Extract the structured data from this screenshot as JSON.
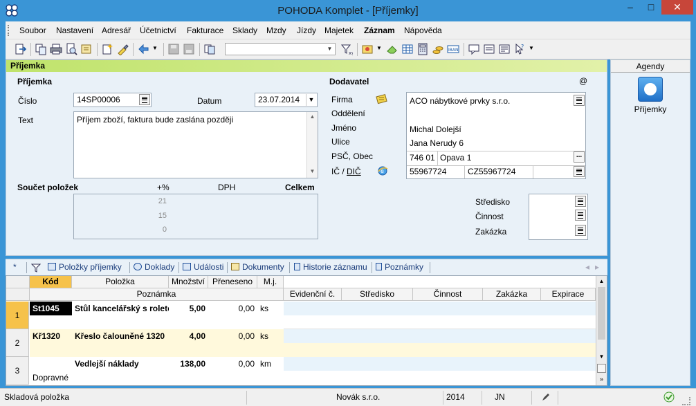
{
  "window": {
    "title": "POHODA Komplet - [Příjemky]",
    "minimize": "–",
    "maximize": "□",
    "close": "✕"
  },
  "menu": [
    "Soubor",
    "Nastavení",
    "Adresář",
    "Účetnictví",
    "Fakturace",
    "Sklady",
    "Mzdy",
    "Jízdy",
    "Majetek",
    "Záznam",
    "Nápověda"
  ],
  "form": {
    "header": "Příjemka",
    "section_left": "Příjemka",
    "cislo_label": "Číslo",
    "cislo_value": "14SP00006",
    "datum_label": "Datum",
    "datum_value": "23.07.2014",
    "text_label": "Text",
    "text_value": "Příjem zboží, faktura bude zaslána později",
    "soucet_label": "Součet položek",
    "plus_pct": "+%",
    "dph": "DPH",
    "celkem": "Celkem",
    "rates": [
      "21",
      "15",
      "0"
    ],
    "section_right": "Dodavatel",
    "at": "@",
    "firma_label": "Firma",
    "firma_value": "ACO nábytkové prvky s.r.o.",
    "oddeleni_label": "Oddělení",
    "jmeno_label": "Jméno",
    "jmeno_value": "Michal Dolejší",
    "ulice_label": "Ulice",
    "ulice_value": "Jana Nerudy 6",
    "psc_label": "PSČ, Obec",
    "psc_value": "746 01",
    "obec_value": "Opava 1",
    "ic_label": "IČ / ",
    "dic_label": "DIČ",
    "ic_value": "55967724",
    "dic_value": "CZ55967724",
    "stredisko_label": "Středisko",
    "cinnost_label": "Činnost",
    "zakazka_label": "Zakázka",
    "dots": "..."
  },
  "agendy": {
    "header": "Agendy",
    "item": "Příjemky"
  },
  "tabs": [
    "Položky příjemky",
    "Doklady",
    "Události",
    "Dokumenty",
    "Historie záznamu",
    "Poznámky"
  ],
  "tabs_aux": {
    "new": "*",
    "left": "◂",
    "right": "▸"
  },
  "grid": {
    "headers1": [
      "Kód",
      "Položka",
      "Množství",
      "Přeneseno",
      "M.j."
    ],
    "poznamka": "Poznámka",
    "headers2": [
      "Evidenční č.",
      "Středisko",
      "Činnost",
      "Zakázka",
      "Expirace"
    ],
    "rows": [
      {
        "n": "1",
        "kod": "St1045",
        "polozka": "Stůl kancelářský s roleto",
        "mnozstvi": "5,00",
        "preneseno": "0,00",
        "mj": "ks",
        "note": ""
      },
      {
        "n": "2",
        "kod": "Kř1320",
        "polozka": "Křeslo čalouněné 1320",
        "mnozstvi": "4,00",
        "preneseno": "0,00",
        "mj": "ks",
        "note": ""
      },
      {
        "n": "3",
        "kod": "",
        "polozka": "Vedlejší náklady",
        "mnozstvi": "138,00",
        "preneseno": "0,00",
        "mj": "km",
        "note": "Dopravné"
      }
    ],
    "scroll": {
      "up": "▲",
      "down": "▼",
      "end": "»"
    }
  },
  "status": {
    "left": "Skladová položka",
    "company": "Novák s.r.o.",
    "year": "2014",
    "user": "JN"
  },
  "colors": {
    "title": "#3a95d6",
    "header_green": "#bfe36b",
    "selected": "#f6c24a",
    "form_bg": "#e9f1f8"
  }
}
